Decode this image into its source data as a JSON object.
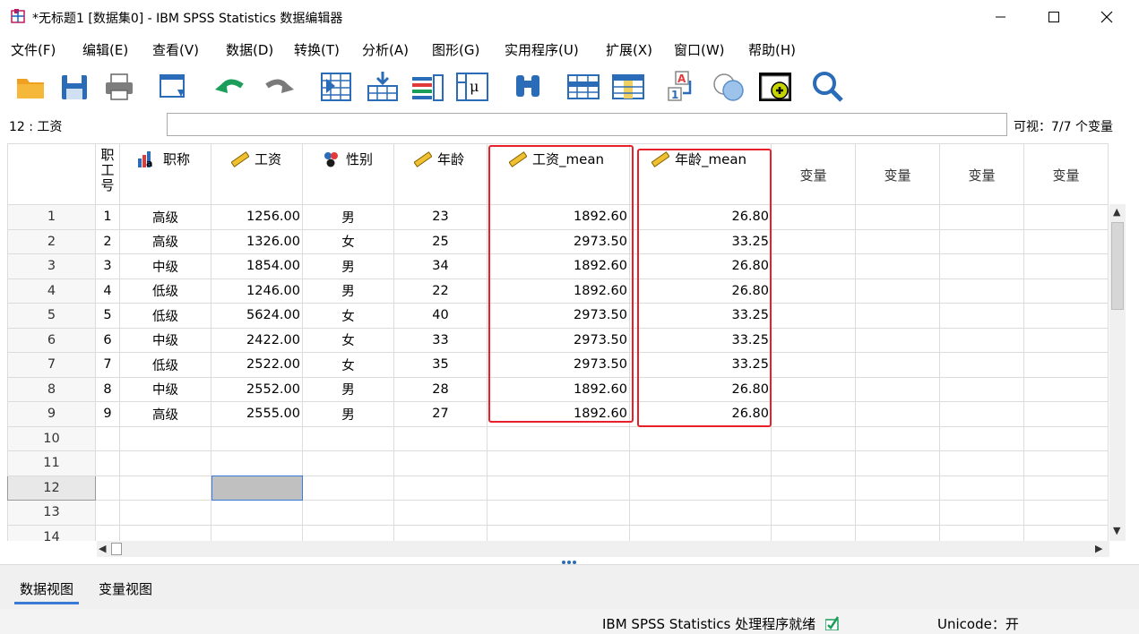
{
  "window": {
    "title": "*无标题1 [数据集0] - IBM SPSS Statistics 数据编辑器"
  },
  "menu": [
    {
      "label": "文件(F)"
    },
    {
      "label": "编辑(E)"
    },
    {
      "label": "查看(V)"
    },
    {
      "label": "数据(D)"
    },
    {
      "label": "转换(T)"
    },
    {
      "label": "分析(A)"
    },
    {
      "label": "图形(G)"
    },
    {
      "label": "实用程序(U)"
    },
    {
      "label": "扩展(X)"
    },
    {
      "label": "窗口(W)"
    },
    {
      "label": "帮助(H)"
    }
  ],
  "toolbar_icons": [
    "open-folder-icon",
    "save-icon",
    "print-icon",
    "dialog-recall-icon",
    "undo-icon",
    "redo-icon",
    "goto-case-icon",
    "goto-variable-icon",
    "variables-icon",
    "run-descriptives-icon",
    "find-icon",
    "insert-cases-icon",
    "insert-variable-icon",
    "split-file-icon",
    "weight-cases-icon",
    "select-cases-icon",
    "value-labels-icon",
    "use-variable-sets-icon",
    "search-icon"
  ],
  "cellbar": {
    "cell_ref": "12 : 工资",
    "cell_value": "",
    "visible": "可视：7/7 个变量"
  },
  "columns": [
    {
      "name": "职\n工\n号",
      "type": "none"
    },
    {
      "name": "职称",
      "type": "nominal-string"
    },
    {
      "name": "工资",
      "type": "scale"
    },
    {
      "name": "性别",
      "type": "nominal"
    },
    {
      "name": "年龄",
      "type": "scale"
    },
    {
      "name": "工资_mean",
      "type": "scale"
    },
    {
      "name": "年龄_mean",
      "type": "scale"
    },
    {
      "name": "变量",
      "type": "empty"
    },
    {
      "name": "变量",
      "type": "empty"
    },
    {
      "name": "变量",
      "type": "empty"
    },
    {
      "name": "变量",
      "type": "empty"
    }
  ],
  "rows": [
    {
      "n": "1",
      "id": "1",
      "title": "高级",
      "salary": "1256.00",
      "gender": "男",
      "age": "23",
      "salary_mean": "1892.60",
      "age_mean": "26.80"
    },
    {
      "n": "2",
      "id": "2",
      "title": "高级",
      "salary": "1326.00",
      "gender": "女",
      "age": "25",
      "salary_mean": "2973.50",
      "age_mean": "33.25"
    },
    {
      "n": "3",
      "id": "3",
      "title": "中级",
      "salary": "1854.00",
      "gender": "男",
      "age": "34",
      "salary_mean": "1892.60",
      "age_mean": "26.80"
    },
    {
      "n": "4",
      "id": "4",
      "title": "低级",
      "salary": "1246.00",
      "gender": "男",
      "age": "22",
      "salary_mean": "1892.60",
      "age_mean": "26.80"
    },
    {
      "n": "5",
      "id": "5",
      "title": "低级",
      "salary": "5624.00",
      "gender": "女",
      "age": "40",
      "salary_mean": "2973.50",
      "age_mean": "33.25"
    },
    {
      "n": "6",
      "id": "6",
      "title": "中级",
      "salary": "2422.00",
      "gender": "女",
      "age": "33",
      "salary_mean": "2973.50",
      "age_mean": "33.25"
    },
    {
      "n": "7",
      "id": "7",
      "title": "低级",
      "salary": "2522.00",
      "gender": "女",
      "age": "35",
      "salary_mean": "2973.50",
      "age_mean": "33.25"
    },
    {
      "n": "8",
      "id": "8",
      "title": "中级",
      "salary": "2552.00",
      "gender": "男",
      "age": "28",
      "salary_mean": "1892.60",
      "age_mean": "26.80"
    },
    {
      "n": "9",
      "id": "9",
      "title": "高级",
      "salary": "2555.00",
      "gender": "男",
      "age": "27",
      "salary_mean": "1892.60",
      "age_mean": "26.80"
    }
  ],
  "empty_rows": [
    "10",
    "11",
    "12",
    "13",
    "14"
  ],
  "selected_row": "12",
  "tabs": [
    {
      "label": "数据视图",
      "active": true
    },
    {
      "label": "变量视图",
      "active": false
    }
  ],
  "status": {
    "processor": "IBM SPSS Statistics 处理程序就绪",
    "unicode": "Unicode：开"
  },
  "colors": {
    "highlight_box": "#e8202a",
    "active_tab": "#3a7bd5",
    "selected_cell": "#c0c0c0"
  }
}
